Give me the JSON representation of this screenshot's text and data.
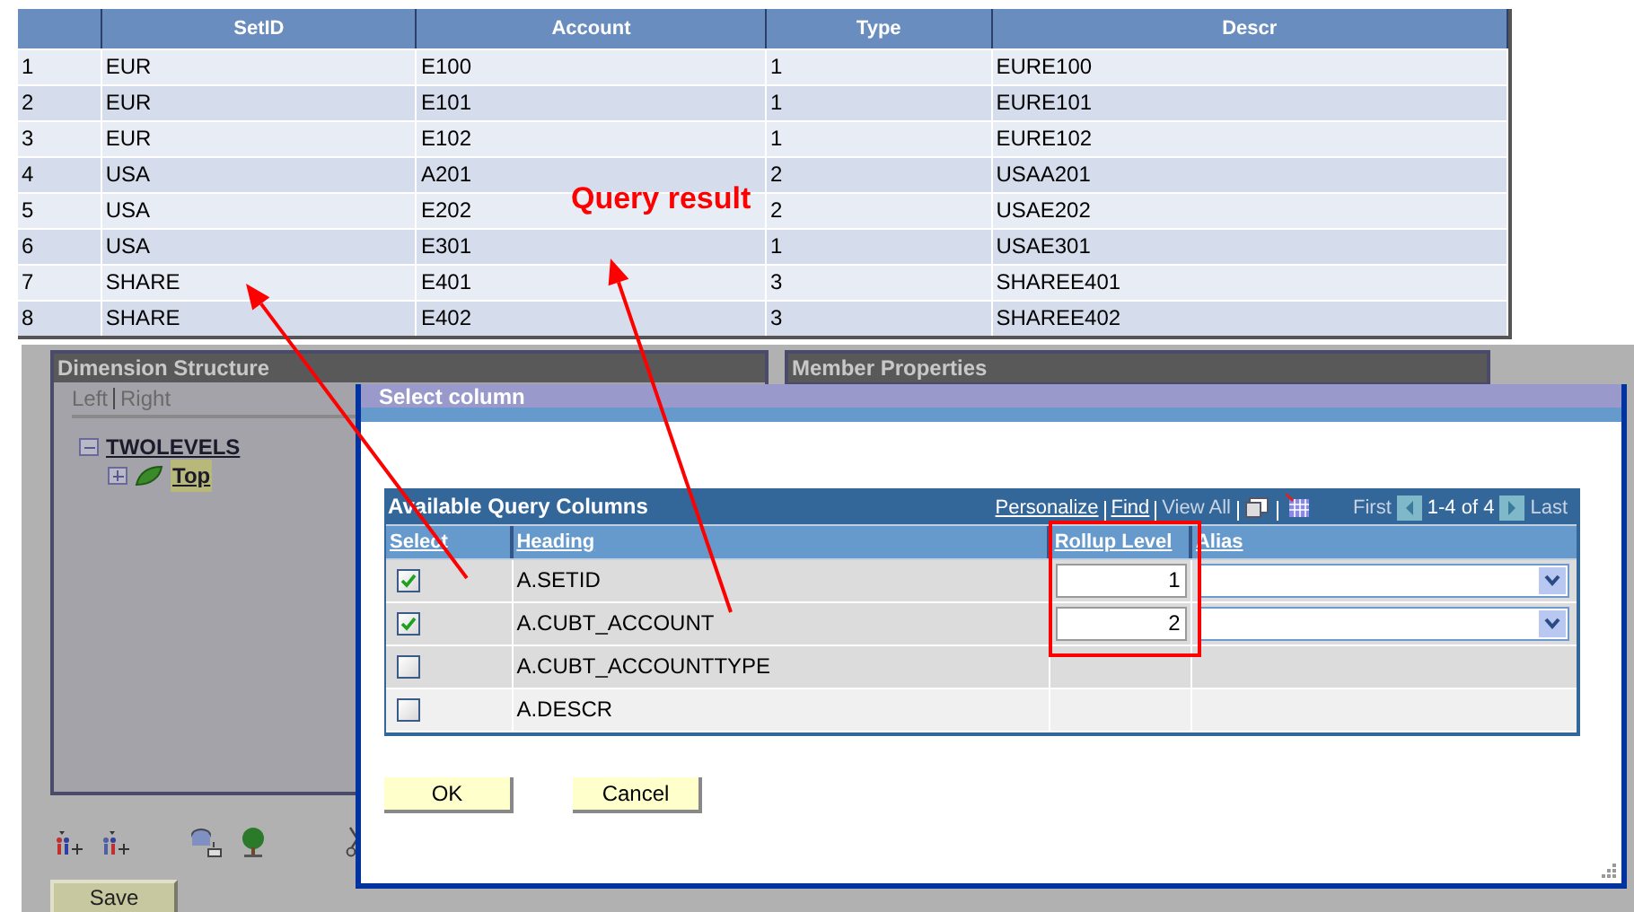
{
  "query_result_table": {
    "columns": [
      "SetID",
      "Account",
      "Type",
      "Descr"
    ],
    "rows": [
      {
        "number": "1",
        "cells": [
          "EUR",
          "E100",
          "1",
          "EURE100"
        ]
      },
      {
        "number": "2",
        "cells": [
          "EUR",
          "E101",
          "1",
          "EURE101"
        ]
      },
      {
        "number": "3",
        "cells": [
          "EUR",
          "E102",
          "1",
          "EURE102"
        ]
      },
      {
        "number": "4",
        "cells": [
          "USA",
          "A201",
          "2",
          "USAA201"
        ]
      },
      {
        "number": "5",
        "cells": [
          "USA",
          "E202",
          "2",
          "USAE202"
        ]
      },
      {
        "number": "6",
        "cells": [
          "USA",
          "E301",
          "1",
          "USAE301"
        ]
      },
      {
        "number": "7",
        "cells": [
          "SHARE",
          "E401",
          "3",
          "SHAREE401"
        ]
      },
      {
        "number": "8",
        "cells": [
          "SHARE",
          "E402",
          "3",
          "SHAREE402"
        ]
      }
    ]
  },
  "annotation": {
    "text": "Query result"
  },
  "dimension_structure": {
    "title": "Dimension Structure",
    "links": [
      "Left",
      "Right"
    ],
    "tree": [
      {
        "label": "TWOLEVELS",
        "expanded": true,
        "selected": false,
        "children": [
          {
            "label": "Top",
            "expanded": false,
            "selected": true
          }
        ]
      }
    ]
  },
  "member_properties": {
    "title": "Member Properties"
  },
  "save_button": "Save",
  "dialog": {
    "title": "Select column",
    "grid": {
      "title": "Available Query Columns",
      "toolbar": [
        {
          "label": "Personalize",
          "disabled": false
        },
        {
          "label": "Find",
          "disabled": false
        },
        {
          "label": "View All",
          "disabled": true
        }
      ],
      "first": "First",
      "range": "1-4 of 4",
      "last": "Last",
      "columns": [
        "Select",
        "Heading",
        "Rollup Level",
        "Alias"
      ],
      "rows": [
        {
          "kind": "input",
          "checked": true,
          "heading": "A.SETID",
          "rollup_level": "1"
        },
        {
          "kind": "input",
          "checked": true,
          "heading": "A.CUBT_ACCOUNT",
          "rollup_level": "2"
        },
        {
          "kind": "plain",
          "checked": false,
          "heading": "A.CUBT_ACCOUNTTYPE"
        },
        {
          "kind": "plain",
          "checked": false,
          "heading": "A.DESCR"
        }
      ]
    },
    "buttons": [
      "OK",
      "Cancel"
    ]
  }
}
